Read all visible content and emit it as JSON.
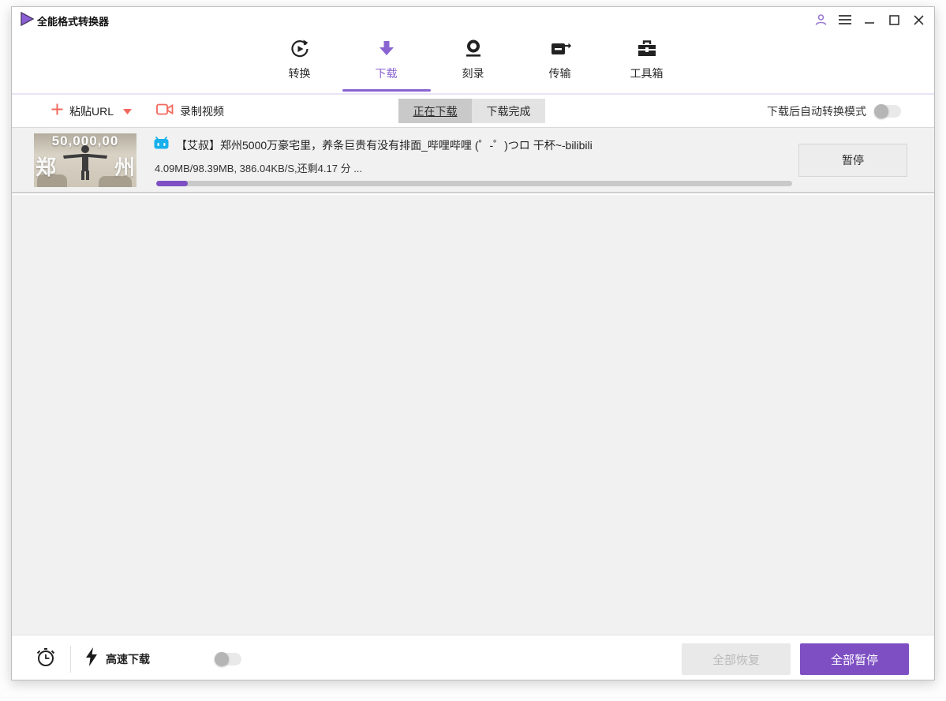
{
  "colors": {
    "accent_purple": "#7d4fc3",
    "accent_purple_light": "#8a63d2",
    "icon_coral": "#f2685c",
    "bilibili_blue": "#17b0ec"
  },
  "titlebar": {
    "app_title": "全能格式转换器",
    "icons": [
      "user-icon",
      "menu-icon",
      "minimize-icon",
      "maximize-icon",
      "close-icon"
    ]
  },
  "nav": {
    "tabs": [
      {
        "label": "转换",
        "icon": "convert-icon",
        "active": false
      },
      {
        "label": "下载",
        "icon": "download-icon",
        "active": true
      },
      {
        "label": "刻录",
        "icon": "burn-icon",
        "active": false
      },
      {
        "label": "传输",
        "icon": "transfer-icon",
        "active": false
      },
      {
        "label": "工具箱",
        "icon": "toolbox-icon",
        "active": false
      }
    ]
  },
  "toolbar": {
    "paste_url_label": "粘贴URL",
    "record_video_label": "录制视频",
    "segments": [
      {
        "label": "正在下载",
        "active": true
      },
      {
        "label": "下载完成",
        "active": false
      }
    ],
    "auto_convert_label": "下载后自动转换模式",
    "auto_convert_on": false
  },
  "download_item": {
    "source_icon": "bilibili-tv-icon",
    "thumbnail_overlay": {
      "top": "50,000,00",
      "left_char": "郑",
      "right_char": "州"
    },
    "title": "【艾叔】郑州5000万豪宅里，养条巨贵有没有排面_哔哩哔哩 (゜-゜)つロ 干杯~-bilibili",
    "progress_text": "4.09MB/98.39MB, 386.04KB/S,还剩4.17 分 ...",
    "progress_percent": 5,
    "pause_label": "暂停"
  },
  "footer": {
    "scheduler_icon": "alarm-clock-icon",
    "speed_icon": "lightning-icon",
    "speed_label": "高速下载",
    "speed_on": false,
    "resume_all_label": "全部恢复",
    "pause_all_label": "全部暂停"
  }
}
